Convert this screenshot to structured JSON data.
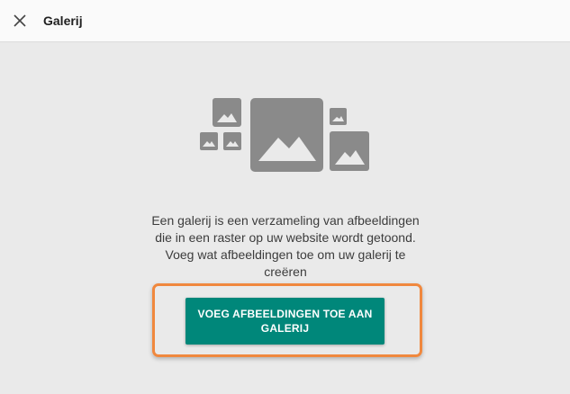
{
  "header": {
    "title": "Galerij",
    "close_icon": "close-icon"
  },
  "illustration": {
    "icon": "image-gallery-icon",
    "color": "#8a8a8a"
  },
  "main": {
    "description_lines": [
      "Een galerij is een verzameling van afbeeldingen",
      "die in een raster op uw website wordt getoond.",
      "Voeg wat afbeeldingen toe om uw galerij te",
      "creëren"
    ],
    "button_lines": [
      "VOEG AFBEELDINGEN TOE AAN",
      "GALERIJ"
    ]
  },
  "colors": {
    "accent": "#00877a",
    "highlight": "#f0883e",
    "background": "#eaeaea",
    "header_background": "#fafafa"
  }
}
